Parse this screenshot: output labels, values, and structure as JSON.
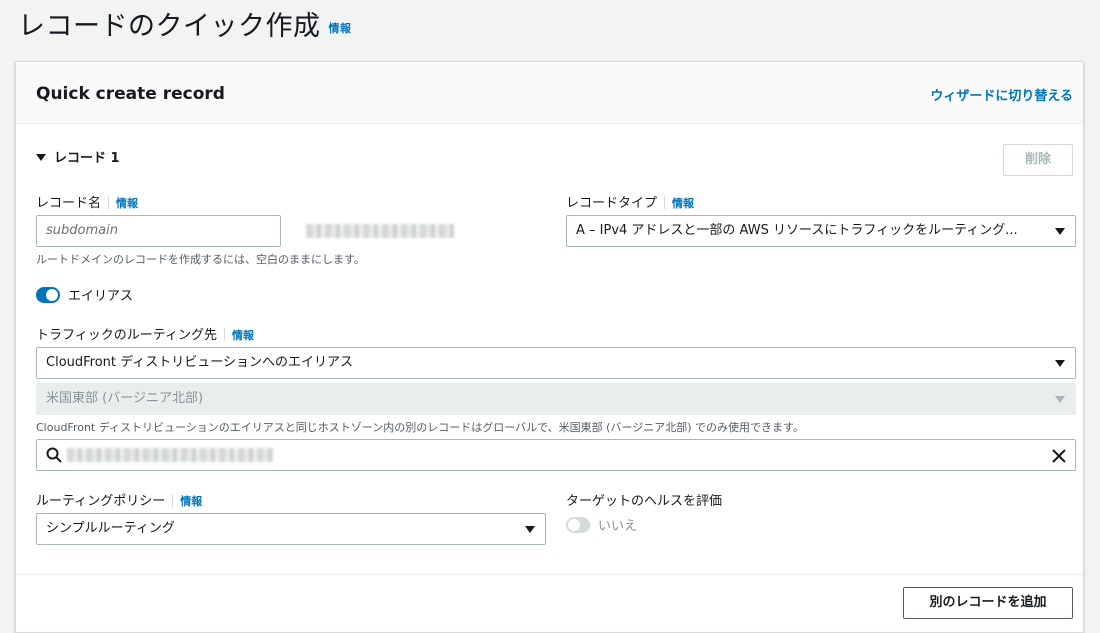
{
  "page": {
    "title": "レコードのクイック作成",
    "info": "情報"
  },
  "panel": {
    "title": "Quick create record",
    "wizard_link": "ウィザードに切り替える"
  },
  "record": {
    "header": "レコード 1",
    "delete_button": "削除",
    "record_name": {
      "label": "レコード名",
      "info": "情報",
      "placeholder": "subdomain",
      "hint": "ルートドメインのレコードを作成するには、空白のままにします。"
    },
    "record_type": {
      "label": "レコードタイプ",
      "info": "情報",
      "value": "A – IPv4 アドレスと一部の AWS リソースにトラフィックをルーティング..."
    },
    "alias": {
      "label": "エイリアス",
      "enabled": true
    },
    "route_traffic": {
      "label": "トラフィックのルーティング先",
      "info": "情報",
      "endpoint_value": "CloudFront ディストリビューションへのエイリアス",
      "region_value": "米国東部 (バージニア北部)",
      "hint": "CloudFront ディストリビューションのエイリアスと同じホストゾーン内の別のレコードはグローバルで、米国東部 (バージニア北部) でのみ使用できます。"
    },
    "routing_policy": {
      "label": "ルーティングポリシー",
      "info": "情報",
      "value": "シンプルルーティング"
    },
    "health": {
      "label": "ターゲットのヘルスを評価",
      "toggle_label": "いいえ",
      "enabled": false
    }
  },
  "footer": {
    "add_button": "別のレコードを追加"
  },
  "colors": {
    "link": "#0073bb",
    "toggle_on": "#0073bb",
    "background": "#f2f3f3"
  }
}
